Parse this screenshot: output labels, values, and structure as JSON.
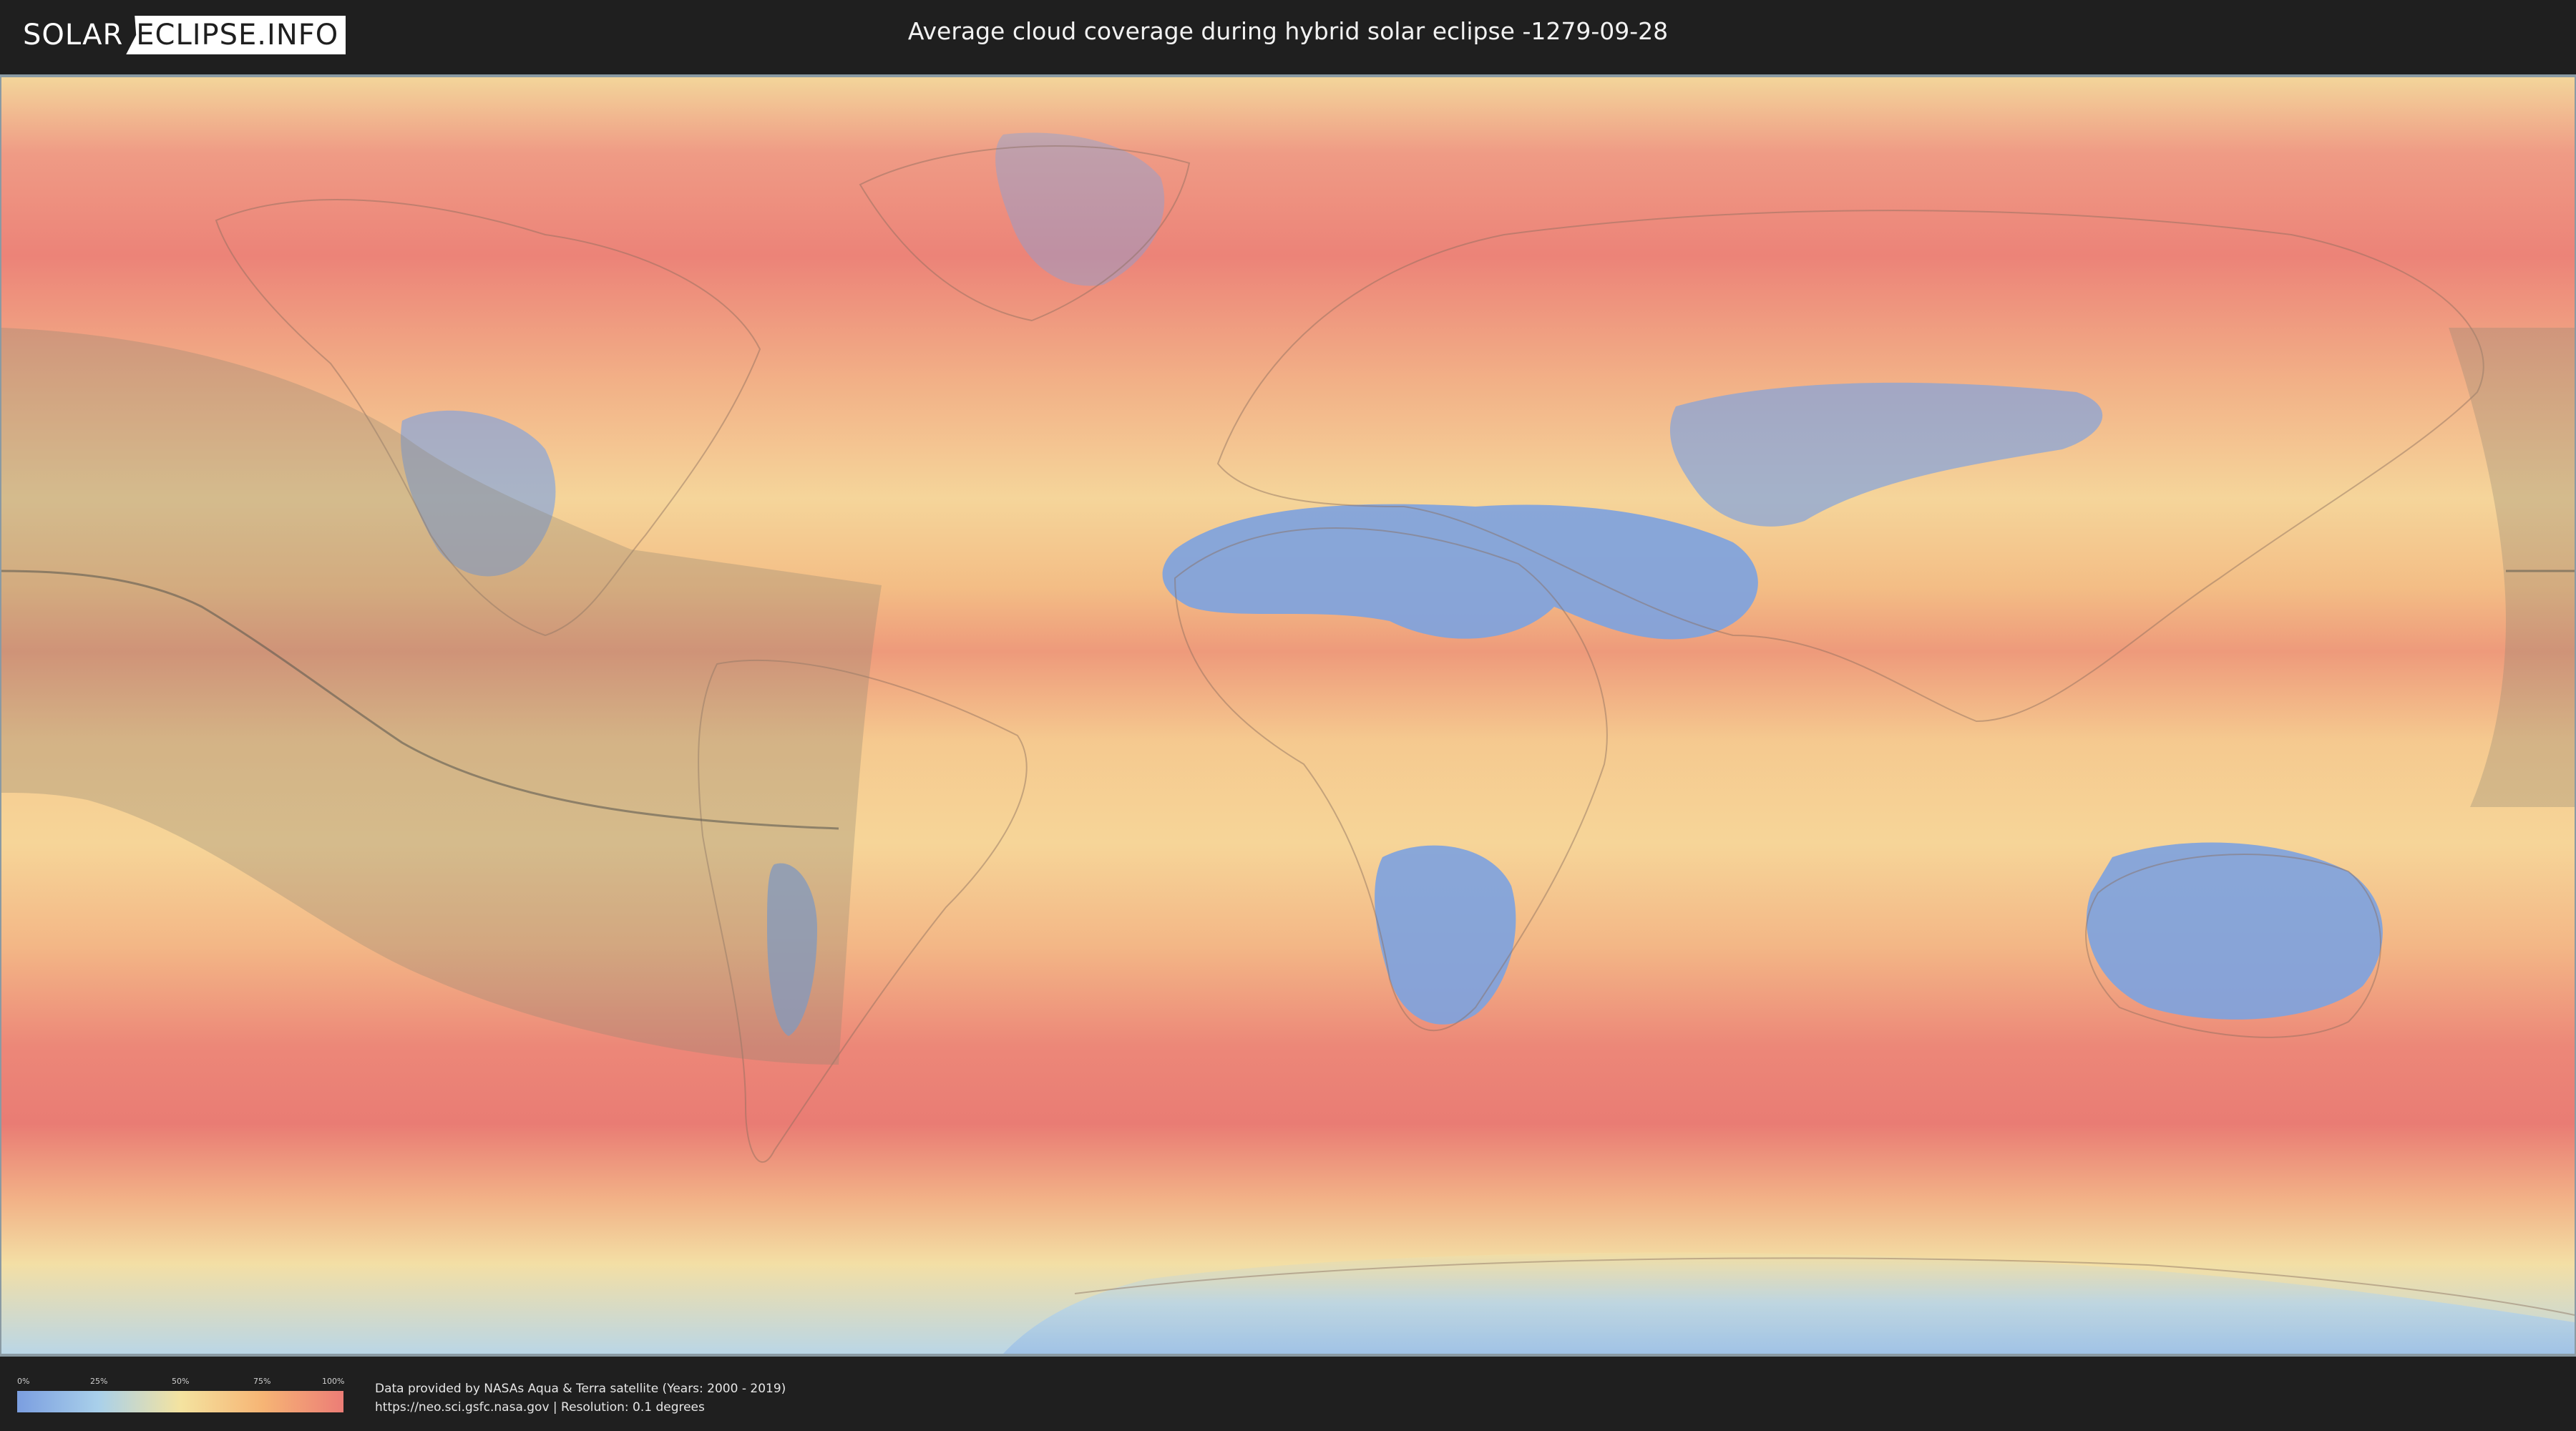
{
  "header": {
    "logo_left": "SOLAR",
    "logo_right": "ECLIPSE.INFO",
    "title": "Average cloud coverage during hybrid solar eclipse -1279-09-28"
  },
  "legend": {
    "ticks": [
      "0%",
      "25%",
      "50%",
      "75%",
      "100%"
    ],
    "colors": [
      "#7b9ee0",
      "#a9d0ea",
      "#f4e3a0",
      "#f6b575",
      "#ec7d76"
    ]
  },
  "footer": {
    "credit_line1": "Data provided by NASAs Aqua & Terra satellite (Years: 2000 - 2019)",
    "credit_line2": "https://neo.sci.gsfc.nasa.gov | Resolution: 0.1 degrees"
  }
}
